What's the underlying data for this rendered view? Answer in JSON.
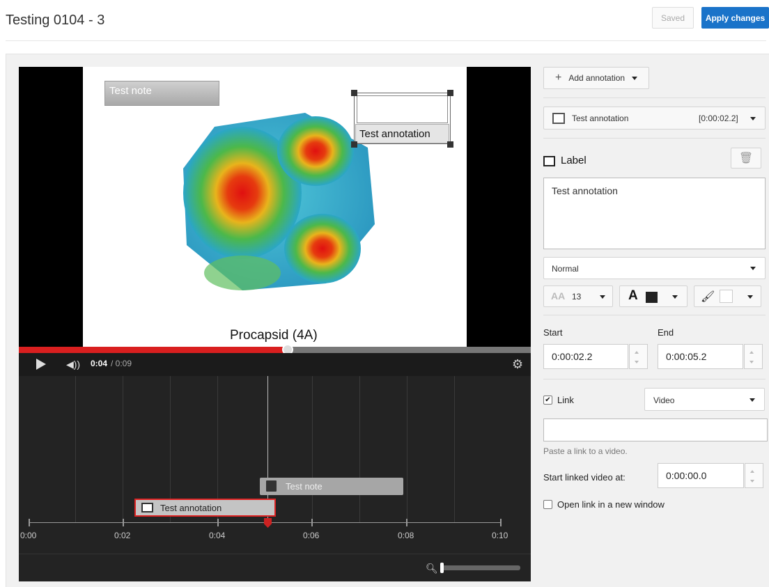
{
  "header": {
    "title": "Testing 0104 - 3",
    "saved_label": "Saved",
    "apply_label": "Apply changes"
  },
  "video": {
    "caption": "Procapsid (4A)",
    "note_text": "Test note",
    "annotation_text": "Test annotation",
    "progress_fraction": 0.525,
    "time_current": "0:04",
    "time_total": "/ 0:09"
  },
  "timeline": {
    "ticks": [
      "0:00",
      "0:02",
      "0:04",
      "0:06",
      "0:08",
      "0:10"
    ],
    "items": [
      {
        "label": "Test note",
        "icon": "note-icon"
      },
      {
        "label": "Test annotation",
        "icon": "label-icon"
      }
    ],
    "zoom_icon": "search-icon"
  },
  "panel": {
    "add_annotation_label": "Add annotation",
    "selected_annotation": "Test annotation",
    "selected_time": "[0:00:02.2]",
    "type_label": "Label",
    "text_value": "Test annotation",
    "style_value": "Normal",
    "font_size": "13",
    "text_color": "#222222",
    "bg_color": "#ffffff",
    "start_label": "Start",
    "end_label": "End",
    "start_value": "0:00:02.2",
    "end_value": "0:00:05.2",
    "link_label": "Link",
    "link_checked": true,
    "link_type": "Video",
    "link_url": "",
    "link_hint": "Paste a link to a video.",
    "start_linked_label": "Start linked video at:",
    "start_linked_value": "0:00:00.0",
    "new_window_label": "Open link in a new window"
  },
  "colors": {
    "accent": "#1a73c9",
    "progress": "#d91f1f"
  }
}
